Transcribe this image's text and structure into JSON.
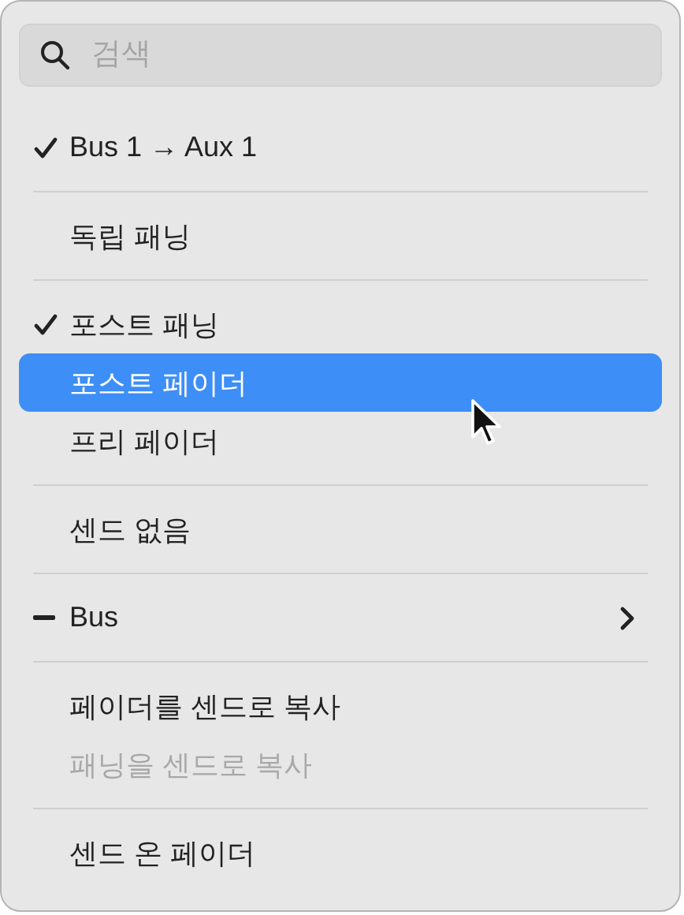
{
  "search": {
    "placeholder": "검색"
  },
  "groups": [
    {
      "items": [
        {
          "label": "Bus 1 → Aux 1",
          "checked": true,
          "mixed": false,
          "selected": false,
          "disabled": false,
          "submenu": false
        }
      ]
    },
    {
      "items": [
        {
          "label": "독립 패닝",
          "checked": false,
          "mixed": false,
          "selected": false,
          "disabled": false,
          "submenu": false
        }
      ]
    },
    {
      "items": [
        {
          "label": "포스트 패닝",
          "checked": true,
          "mixed": false,
          "selected": false,
          "disabled": false,
          "submenu": false
        },
        {
          "label": "포스트 페이더",
          "checked": false,
          "mixed": false,
          "selected": true,
          "disabled": false,
          "submenu": false
        },
        {
          "label": "프리 페이더",
          "checked": false,
          "mixed": false,
          "selected": false,
          "disabled": false,
          "submenu": false
        }
      ]
    },
    {
      "items": [
        {
          "label": "센드 없음",
          "checked": false,
          "mixed": false,
          "selected": false,
          "disabled": false,
          "submenu": false
        }
      ]
    },
    {
      "items": [
        {
          "label": "Bus",
          "checked": false,
          "mixed": true,
          "selected": false,
          "disabled": false,
          "submenu": true
        }
      ]
    },
    {
      "items": [
        {
          "label": "페이더를 센드로 복사",
          "checked": false,
          "mixed": false,
          "selected": false,
          "disabled": false,
          "submenu": false
        },
        {
          "label": "패닝을 센드로 복사",
          "checked": false,
          "mixed": false,
          "selected": false,
          "disabled": true,
          "submenu": false
        }
      ]
    },
    {
      "items": [
        {
          "label": "센드 온 페이더",
          "checked": false,
          "mixed": false,
          "selected": false,
          "disabled": false,
          "submenu": false
        }
      ]
    }
  ]
}
